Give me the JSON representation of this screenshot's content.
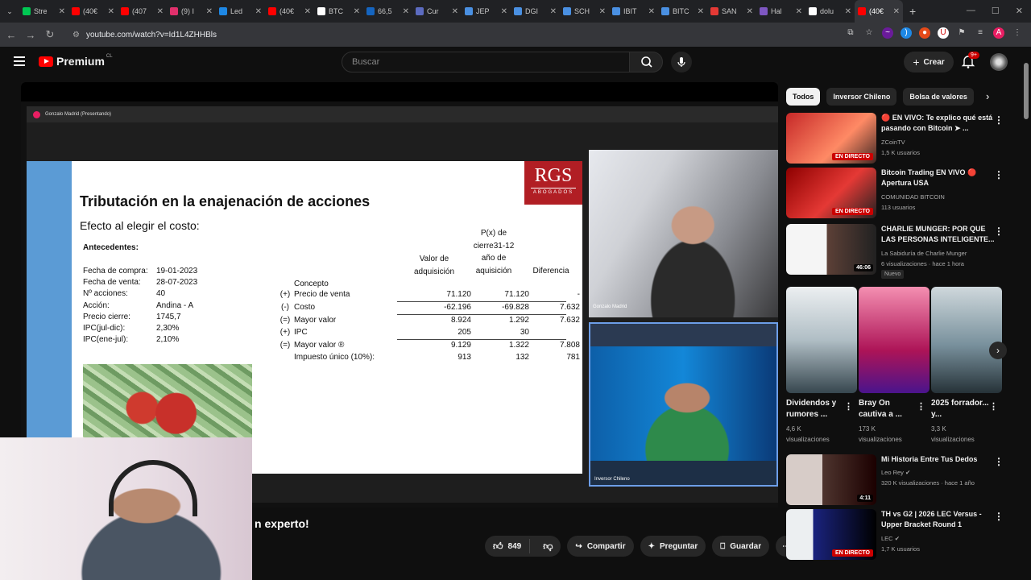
{
  "browser": {
    "tabs": [
      {
        "label": "Stre",
        "color": "#00c853"
      },
      {
        "label": "(40€",
        "color": "#ff0000"
      },
      {
        "label": "(407",
        "color": "#ff0000"
      },
      {
        "label": "(9) I",
        "color": "#e1306c"
      },
      {
        "label": "Led",
        "color": "#1e88e5"
      },
      {
        "label": "(40€",
        "color": "#ff0000"
      },
      {
        "label": "BTC",
        "color": "#ffffff"
      },
      {
        "label": "66,5",
        "color": "#1565c0"
      },
      {
        "label": "Cur",
        "color": "#5c6bc0"
      },
      {
        "label": "JEP",
        "color": "#4a90e2"
      },
      {
        "label": "DGI",
        "color": "#4a90e2"
      },
      {
        "label": "SCH",
        "color": "#4a90e2"
      },
      {
        "label": "IBIT",
        "color": "#4a90e2"
      },
      {
        "label": "BITC",
        "color": "#4a90e2"
      },
      {
        "label": "SAN",
        "color": "#e53935"
      },
      {
        "label": "Hal",
        "color": "#7e57c2"
      },
      {
        "label": "dolu",
        "color": "#ffffff"
      },
      {
        "label": "(40€",
        "color": "#ff0000",
        "active": true
      }
    ],
    "url": "youtube.com/watch?v=Id1L4ZHHBls",
    "profile_initial": "A"
  },
  "youtube": {
    "brand": "Premium",
    "region": "CL",
    "search_placeholder": "Buscar",
    "create_label": "Crear",
    "notif_count": "9+"
  },
  "meeting": {
    "presenter_label": "Gonzalo Madrid (Presentando)",
    "cam1_name": "Gonzalo Madrid",
    "cam2_name": "Inversor Chileno"
  },
  "slide": {
    "logo_main": "RGS",
    "logo_sub": "ABOGADOS",
    "title": "Tributación en la enajenación de acciones",
    "subtitle": "Efecto al elegir el costo:",
    "antecedentes_label": "Antecedentes:",
    "facts": [
      {
        "label": "Fecha de compra:",
        "value": "19-01-2023"
      },
      {
        "label": "Fecha de venta:",
        "value": "28-07-2023"
      },
      {
        "label": "Nº acciones:",
        "value": "40"
      },
      {
        "label": "Acción:",
        "value": "Andina - A"
      },
      {
        "label": "Precio cierre:",
        "value": "1745,7"
      },
      {
        "label": "IPC(jul-dic):",
        "value": "2,30%"
      },
      {
        "label": "IPC(ene-jul):",
        "value": "2,10%"
      }
    ],
    "headers": {
      "concepto": "Concepto",
      "col1_l1": "Valor de",
      "col1_l2": "adquisición",
      "col2_l1": "P(x) de",
      "col2_l2": "cierre31-12",
      "col2_l3": "año de",
      "col2_l4": "aquisición",
      "col3": "Diferencia"
    },
    "rows": [
      {
        "sign": "(+)",
        "concept": "Precio de venta",
        "v1": "71.120",
        "v2": "71.120",
        "v3": "-"
      },
      {
        "sign": "(-)",
        "concept": "Costo",
        "v1": "-62.196",
        "v2": "-69.828",
        "v3": "7.632"
      },
      {
        "sign": "(=)",
        "concept": "Mayor valor",
        "v1": "8.924",
        "v2": "1.292",
        "v3": "7.632"
      },
      {
        "sign": "(+)",
        "concept": "IPC",
        "v1": "205",
        "v2": "30",
        "v3": ""
      },
      {
        "sign": "(=)",
        "concept": "Mayor valor ®",
        "v1": "9.129",
        "v2": "1.322",
        "v3": "7.808"
      },
      {
        "sign": "",
        "concept": "Impuesto único (10%):",
        "v1": "913",
        "v2": "132",
        "v3": "781"
      }
    ]
  },
  "video": {
    "title_fragment": "n experto!",
    "likes": "849",
    "share_label": "Compartir",
    "ask_label": "Preguntar",
    "save_label": "Guardar"
  },
  "chips": [
    "Todos",
    "Inversor Chileno",
    "Bolsa de valores"
  ],
  "recommendations": [
    {
      "title": "🔴 EN VIVO: Te explico qué está pasando con Bitcoin ➤ ...",
      "channel": "ZCoinTV",
      "meta": "1,5 K usuarios",
      "badge": "EN DIRECTO",
      "thumb_colors": [
        "#b71c1c",
        "#e53935"
      ]
    },
    {
      "title": "Bitcoin Trading EN VIVO 🔴 Apertura USA",
      "channel": "COMUNIDAD BITCOIN",
      "meta": "113 usuarios",
      "badge": "EN DIRECTO",
      "thumb_colors": [
        "#7f0000",
        "#c62828"
      ]
    },
    {
      "title": "CHARLIE MUNGER: POR QUE LAS PERSONAS INTELIGENTE...",
      "channel": "La Sabiduría de Charlie Munger",
      "meta": "6 visualizaciones · hace 1 hora",
      "duration": "46:06",
      "tag": "Nuevo",
      "thumb_colors": [
        "#e0e0e0",
        "#424242"
      ]
    }
  ],
  "shorts": [
    {
      "title": "Dividendos y rumores ...",
      "views": "4,6 K",
      "views_label": "visualizaciones",
      "colors": [
        "#cfd8dc",
        "#546e7a"
      ]
    },
    {
      "title": "Bray On cautiva a ...",
      "views": "173 K",
      "views_label": "visualizaciones",
      "colors": [
        "#ad1457",
        "#f06292"
      ]
    },
    {
      "title": "2025 forrador... y...",
      "views": "3,3 K",
      "views_label": "visualizaciones",
      "colors": [
        "#90a4ae",
        "#37474f"
      ]
    }
  ],
  "bottom_recs": [
    {
      "title": "Mi Historia Entre Tus Dedos",
      "channel": "Leo Rey",
      "meta": "320 K visualizaciones · hace 1 año",
      "duration": "4:11",
      "thumb_colors": [
        "#3e2723",
        "#a1887f"
      ]
    },
    {
      "title": "TH vs G2 | 2026 LEC Versus - Upper Bracket Round 1",
      "channel": "LEC",
      "meta": "1,7 K usuarios",
      "badge": "EN DIRECTO",
      "thumb_colors": [
        "#1a237e",
        "#263238"
      ]
    }
  ]
}
